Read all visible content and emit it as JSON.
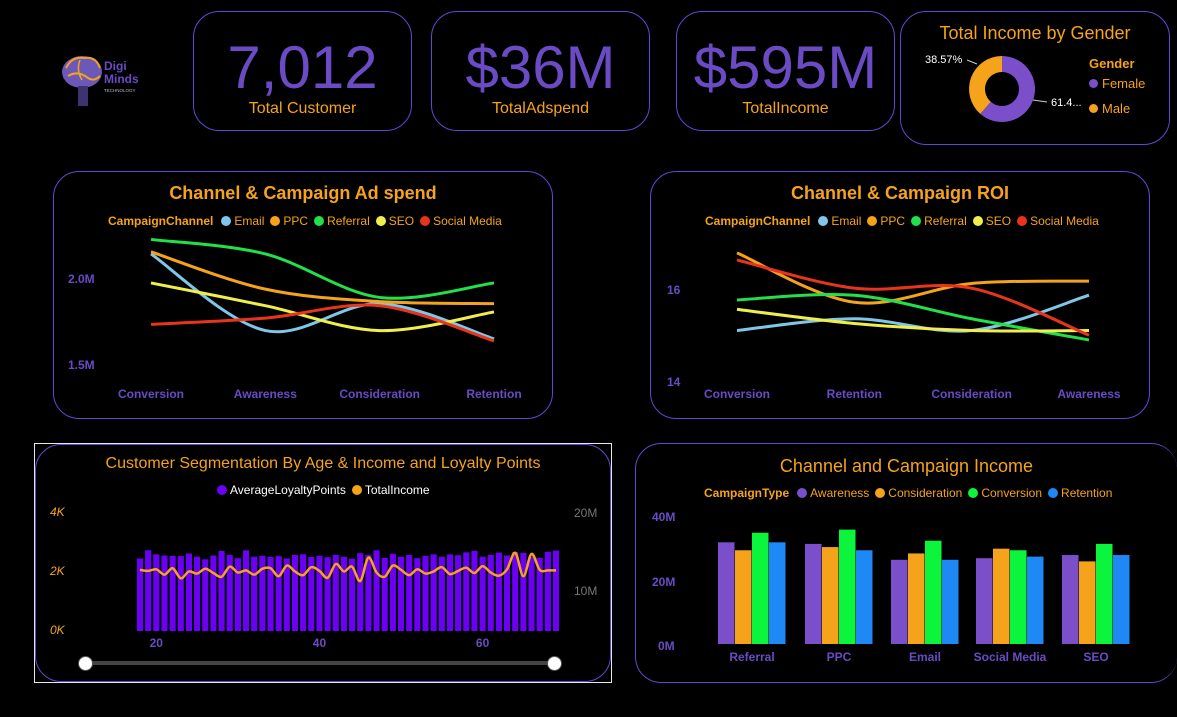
{
  "logo": {
    "line1": "Digi",
    "line2": "Minds",
    "line3": "TECHNOLOGY"
  },
  "kpis": [
    {
      "value": "7,012",
      "label": "Total Customer"
    },
    {
      "value": "$36M",
      "label": "TotalAdspend"
    },
    {
      "value": "$595M",
      "label": "TotalIncome"
    }
  ],
  "gender": {
    "title": "Total Income by Gender",
    "legend_title": "Gender",
    "slices": [
      {
        "name": "Female",
        "value": 61.43,
        "label": "61.4...",
        "color": "#7b4fc9"
      },
      {
        "name": "Male",
        "value": 38.57,
        "label": "38.57%",
        "color": "#f5a31a"
      }
    ]
  },
  "adspend": {
    "title": "Channel & Campaign Ad spend",
    "legend_title": "CampaignChannel",
    "y_ticks": [
      "2.0M",
      "1.5M"
    ]
  },
  "roi": {
    "title": "Channel & Campaign ROI",
    "legend_title": "CampaignChannel",
    "y_ticks": [
      "16",
      "14"
    ]
  },
  "segmentation": {
    "title": "Customer Segmentation By Age & Income and Loyalty Points",
    "legend": [
      {
        "name": "AverageLoyaltyPoints",
        "color": "#6a00f4"
      },
      {
        "name": "TotalIncome",
        "color": "#f5a31a"
      }
    ],
    "y_left_ticks": [
      "4K",
      "2K",
      "0K"
    ],
    "y_right_ticks": [
      "20M",
      "10M"
    ],
    "x_ticks": [
      "20",
      "40",
      "60"
    ]
  },
  "income": {
    "title": "Channel and Campaign Income",
    "legend_title": "CampaignType",
    "y_ticks": [
      "40M",
      "20M",
      "0M"
    ]
  },
  "colors": {
    "accent": "#f5a31a",
    "purple": "#6a4bc4",
    "border": "#5b4bd4"
  },
  "chart_data": [
    {
      "type": "line",
      "title": "Channel & Campaign Ad spend",
      "categories": [
        "Conversion",
        "Awareness",
        "Consideration",
        "Retention"
      ],
      "ylim": [
        1.45,
        2.15
      ],
      "series": [
        {
          "name": "Email",
          "color": "#7fc6e8",
          "values": [
            2.02,
            1.65,
            1.78,
            1.61
          ]
        },
        {
          "name": "PPC",
          "color": "#f5a31a",
          "values": [
            2.03,
            1.85,
            1.79,
            1.78
          ]
        },
        {
          "name": "Referral",
          "color": "#22e04a",
          "values": [
            2.09,
            2.02,
            1.81,
            1.88
          ]
        },
        {
          "name": "SEO",
          "color": "#f0ee4a",
          "values": [
            1.88,
            1.77,
            1.65,
            1.74
          ]
        },
        {
          "name": "Social Media",
          "color": "#e8341c",
          "values": [
            1.68,
            1.71,
            1.77,
            1.6
          ]
        }
      ]
    },
    {
      "type": "line",
      "title": "Channel & Campaign ROI",
      "categories": [
        "Conversion",
        "Retention",
        "Consideration",
        "Awareness"
      ],
      "ylim": [
        13.8,
        17.2
      ],
      "series": [
        {
          "name": "Email",
          "color": "#7fc6e8",
          "values": [
            15.0,
            15.25,
            15.0,
            15.75
          ]
        },
        {
          "name": "PPC",
          "color": "#f5a31a",
          "values": [
            16.65,
            15.6,
            16.0,
            16.05
          ]
        },
        {
          "name": "Referral",
          "color": "#22e04a",
          "values": [
            15.65,
            15.75,
            15.25,
            14.8
          ]
        },
        {
          "name": "SEO",
          "color": "#f0ee4a",
          "values": [
            15.45,
            15.15,
            15.0,
            15.0
          ]
        },
        {
          "name": "Social Media",
          "color": "#e8341c",
          "values": [
            16.5,
            15.9,
            15.9,
            14.9
          ]
        }
      ]
    },
    {
      "type": "bar",
      "title": "Customer Segmentation By Age & Income and Loyalty Points",
      "x": [
        18,
        19,
        20,
        21,
        22,
        23,
        24,
        25,
        26,
        27,
        28,
        29,
        30,
        31,
        32,
        33,
        34,
        35,
        36,
        37,
        38,
        39,
        40,
        41,
        42,
        43,
        44,
        45,
        46,
        47,
        48,
        49,
        50,
        51,
        52,
        53,
        54,
        55,
        56,
        57,
        58,
        59,
        60,
        61,
        62,
        63,
        64,
        65,
        66,
        67,
        68,
        69
      ],
      "series": [
        {
          "name": "AverageLoyaltyPoints",
          "axis": "left",
          "ylim": [
            0,
            4000
          ],
          "values": [
            2480,
            2760,
            2620,
            2580,
            2570,
            2560,
            2650,
            2540,
            2450,
            2580,
            2740,
            2600,
            2490,
            2760,
            2540,
            2570,
            2530,
            2560,
            2480,
            2600,
            2620,
            2530,
            2570,
            2520,
            2600,
            2540,
            2470,
            2660,
            2600,
            2760,
            2500,
            2640,
            2540,
            2600,
            2490,
            2570,
            2620,
            2540,
            2620,
            2590,
            2690,
            2740,
            2540,
            2600,
            2680,
            2580,
            2700,
            2670,
            2540,
            2500,
            2710,
            2750
          ]
        },
        {
          "name": "TotalIncome",
          "axis": "right",
          "ylim": [
            0,
            22
          ],
          "values": [
            11.5,
            11.3,
            11.6,
            10.6,
            11.8,
            9.9,
            11.2,
            10.8,
            11.7,
            10.9,
            10.2,
            12.1,
            11.0,
            11.4,
            10.6,
            11.7,
            11.8,
            10.3,
            12.3,
            11.2,
            10.5,
            12.0,
            11.3,
            10.0,
            12.6,
            11.2,
            12.1,
            9.4,
            13.8,
            11.0,
            10.2,
            12.3,
            11.5,
            10.5,
            11.6,
            10.8,
            11.2,
            12.0,
            10.7,
            11.3,
            11.9,
            10.9,
            12.2,
            11.0,
            10.4,
            11.6,
            14.7,
            10.3,
            14.5,
            11.5,
            11.4,
            11.4
          ]
        }
      ]
    },
    {
      "type": "bar",
      "title": "Channel and Campaign Income",
      "categories": [
        "Referral",
        "PPC",
        "Email",
        "Social Media",
        "SEO"
      ],
      "ylim": [
        0,
        45
      ],
      "series": [
        {
          "name": "Awareness",
          "color": "#7b4fc9",
          "values": [
            32,
            31.5,
            26.5,
            27,
            28
          ]
        },
        {
          "name": "Consideration",
          "color": "#f5a31a",
          "values": [
            29.5,
            30.5,
            28.5,
            30,
            26
          ]
        },
        {
          "name": "Conversion",
          "color": "#0bf53c",
          "values": [
            35,
            36,
            32.5,
            29.5,
            31.5
          ]
        },
        {
          "name": "Retention",
          "color": "#1e88f5",
          "values": [
            32,
            29.5,
            26.5,
            27.5,
            28
          ]
        }
      ]
    }
  ]
}
